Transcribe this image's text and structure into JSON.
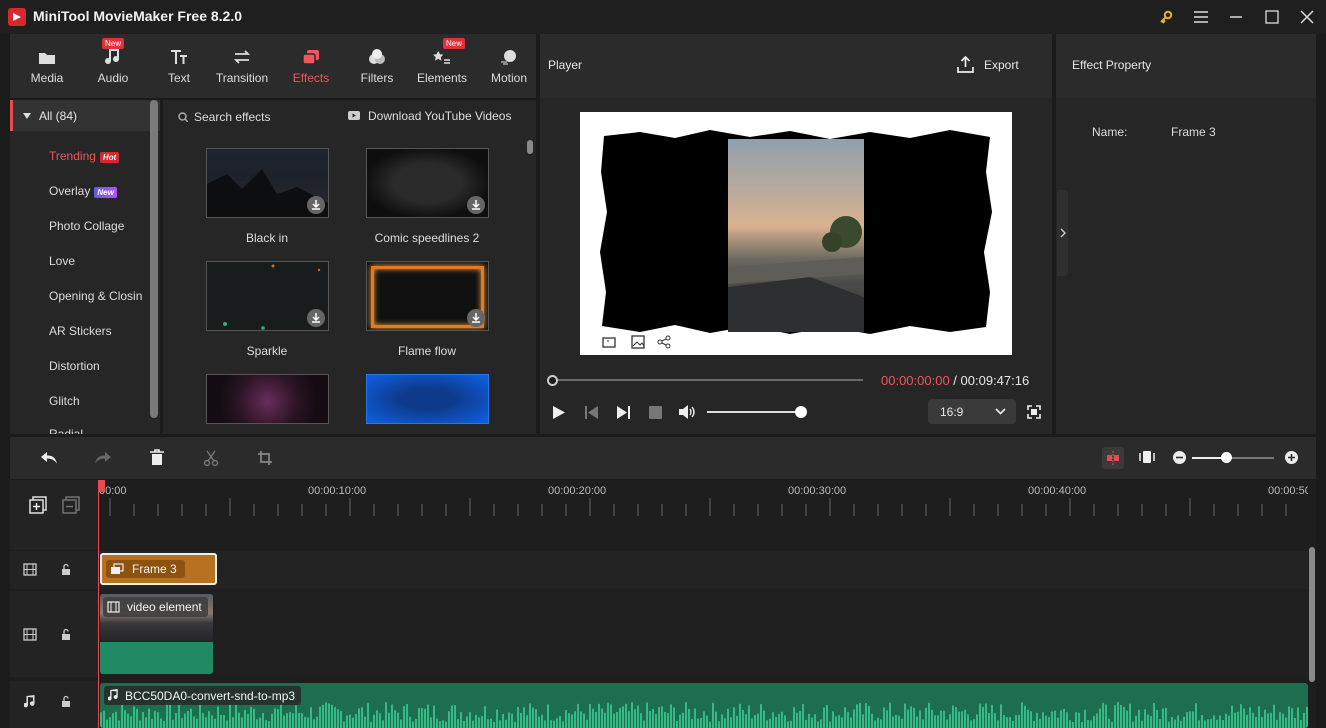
{
  "app": {
    "title": "MiniTool MovieMaker Free 8.2.0"
  },
  "toolbar": {
    "media": "Media",
    "audio": "Audio",
    "text": "Text",
    "transition": "Transition",
    "effects": "Effects",
    "filters": "Filters",
    "elements": "Elements",
    "motion": "Motion",
    "new_badge": "New"
  },
  "sidebar": {
    "all": "All (84)",
    "items": [
      {
        "label": "Trending",
        "badge": "Hot"
      },
      {
        "label": "Overlay",
        "badge": "New"
      },
      {
        "label": "Photo Collage"
      },
      {
        "label": "Love"
      },
      {
        "label": "Opening & Closin"
      },
      {
        "label": "AR Stickers"
      },
      {
        "label": "Distortion"
      },
      {
        "label": "Glitch"
      },
      {
        "label": "Radial"
      }
    ]
  },
  "effects": {
    "search_placeholder": "Search effects",
    "download_youtube": "Download YouTube Videos",
    "items": [
      {
        "label": "Black in"
      },
      {
        "label": "Comic speedlines 2"
      },
      {
        "label": "Sparkle"
      },
      {
        "label": "Flame flow"
      },
      {
        "label": ""
      },
      {
        "label": ""
      }
    ]
  },
  "player": {
    "title": "Player",
    "export": "Export",
    "time_current": "00:00:00:00",
    "time_separator": " / ",
    "time_total": "00:09:47:16",
    "aspect": "16:9",
    "progress": 0.0,
    "volume": 1.0
  },
  "property": {
    "title": "Effect Property",
    "name_label": "Name:",
    "name_value": "Frame 3"
  },
  "timeline": {
    "ruler": [
      "00:00",
      "00:00:10:00",
      "00:00:20:00",
      "00:00:30:00",
      "00:00:40:00",
      "00:00:50"
    ],
    "clips": {
      "effect": "Frame 3",
      "video": "video element",
      "audio": "BCC50DA0-convert-snd-to-mp3"
    },
    "zoom": 0.45
  },
  "colors": {
    "accent": "#f0565b",
    "clip_orange": "#b8711f",
    "audio_green": "#2a9d6b",
    "video_green": "#1f8a63"
  }
}
